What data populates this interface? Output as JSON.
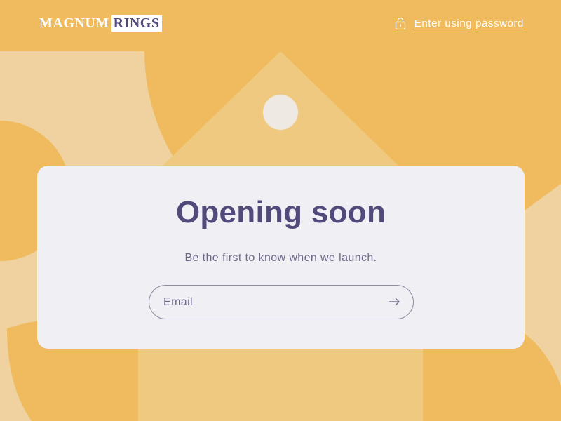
{
  "header": {
    "logo_part1": "MAGNUM",
    "logo_part2": "RINGS",
    "password_link_label": "Enter using password",
    "lock_icon": "lock-icon"
  },
  "main": {
    "heading": "Opening soon",
    "subtitle": "Be the first to know when we launch.",
    "email_placeholder": "Email",
    "email_value": "",
    "submit_icon": "arrow-right-icon"
  },
  "colors": {
    "background": "#efbb5e",
    "shape_light": "#efd29f",
    "shape_mid": "#efc97f",
    "dot": "#efe9e3",
    "cream": "#efe9e3",
    "card": "#efeff4",
    "accent": "#524a7b",
    "muted_text": "#6d6a89"
  }
}
